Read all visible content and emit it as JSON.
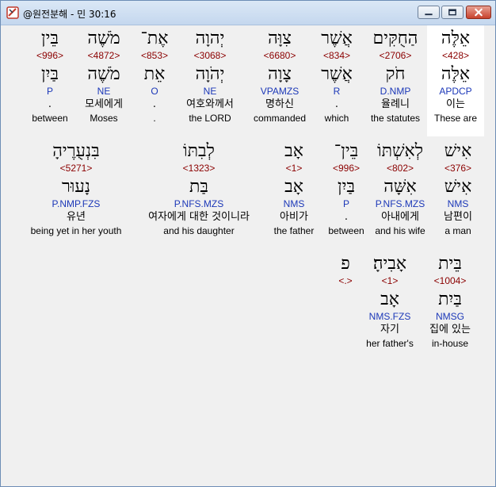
{
  "window": {
    "title": "@원전분해 - 민 30:16",
    "minimize_symbol": "–",
    "maximize_symbol": "□",
    "close_symbol": "✕"
  },
  "rows": [
    {
      "words": [
        {
          "heb": "אֵלֶּה",
          "strong": "<428>",
          "lemma": "אֵלֶּה",
          "parse": "APDCP",
          "kor": "이는",
          "eng": "These are",
          "selected": true
        },
        {
          "heb": "הַחֻקִּים",
          "strong": "<2706>",
          "lemma": "חֹק",
          "parse": "D.NMP",
          "kor": "율례니",
          "eng": "the statutes"
        },
        {
          "heb": "אֲשֶׁר",
          "strong": "<834>",
          "lemma": "אֲשֶׁר",
          "parse": "R",
          "kor": ".",
          "eng": "which"
        },
        {
          "heb": "צִוָּה",
          "strong": "<6680>",
          "lemma": "צָוָה",
          "parse": "VPAMZS",
          "kor": "명하신",
          "eng": "commanded"
        },
        {
          "heb": "יְהוָה",
          "strong": "<3068>",
          "lemma": "יְהֹוָה",
          "parse": "NE",
          "kor": "여호와께서",
          "eng": "the LORD"
        },
        {
          "heb": "אֶת־",
          "strong": "<853>",
          "lemma": "אֵת",
          "parse": "O",
          "kor": ".",
          "eng": "."
        },
        {
          "heb": "מֹשֶׁה",
          "strong": "<4872>",
          "lemma": "מֹשֶׁה",
          "parse": "NE",
          "kor": "모세에게",
          "eng": "Moses"
        },
        {
          "heb": "בֵּין",
          "strong": "<996>",
          "lemma": "בַּיִן",
          "parse": "P",
          "kor": ".",
          "eng": "between"
        }
      ]
    },
    {
      "words": [
        {
          "heb": "אִישׁ",
          "strong": "<376>",
          "lemma": "אִישׁ",
          "parse": "NMS",
          "kor": "남편이",
          "eng": "a man"
        },
        {
          "heb": "לְאִשְׁתּוֹ",
          "strong": "<802>",
          "lemma": "אִשָּׁה",
          "parse": "P.NFS.MZS",
          "kor": "아내에게",
          "eng": "and his wife"
        },
        {
          "heb": "בֵּין־",
          "strong": "<996>",
          "lemma": "בַּיִן",
          "parse": "P",
          "kor": ".",
          "eng": "between"
        },
        {
          "heb": "אָב",
          "strong": "<1>",
          "lemma": "אָב",
          "parse": "NMS",
          "kor": "아비가",
          "eng": "the father"
        },
        {
          "heb": "לְבִתּוֹ",
          "strong": "<1323>",
          "lemma": "בַּת",
          "parse": "P.NFS.MZS",
          "kor": "여자에게 대한 것이니라",
          "eng": "and his daughter"
        },
        {
          "heb": "בִּנְעֻרֶיהָ",
          "strong": "<5271>",
          "lemma": "נָעוּר",
          "parse": "P.NMP.FZS",
          "kor": "유년",
          "eng": "being yet in her youth"
        }
      ]
    },
    {
      "words": [
        {
          "heb": "בֵּית",
          "strong": "<1004>",
          "lemma": "בַּיִת",
          "parse": "NMSG",
          "kor": "집에 있는",
          "eng": "in-house"
        },
        {
          "heb": "אָבִיהָ׃",
          "strong": "<1>",
          "lemma": "אָב",
          "parse": "NMS.FZS",
          "kor": "자기",
          "eng": "her father's"
        },
        {
          "heb": "פ",
          "strong": "<.>",
          "lemma": "",
          "parse": "",
          "kor": "",
          "eng": ""
        }
      ]
    }
  ]
}
